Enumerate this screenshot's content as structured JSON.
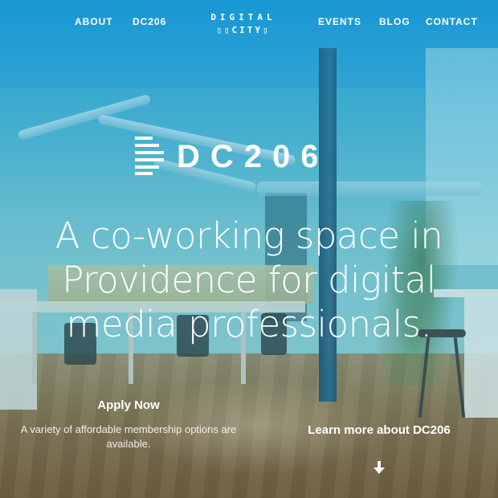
{
  "nav": {
    "left_links": [
      {
        "label": "ABOUT"
      },
      {
        "label": "DC206"
      }
    ],
    "logo": {
      "line1": "DIGITAL",
      "line2": "▯▯CITY▯"
    },
    "right_links": [
      {
        "label": "EVENTS"
      },
      {
        "label": "BLOG"
      },
      {
        "label": "CONTACT"
      }
    ]
  },
  "hero": {
    "brand_name": "DC206",
    "brand_icon": "stacked-lines-icon",
    "headline": "A co-working space in Providence for digital media professionals.",
    "apply": {
      "label": "Apply Now",
      "description": "A variety of affordable membership options are available."
    },
    "learn_more": {
      "label": "Learn more about DC206",
      "icon": "arrow-down-icon"
    }
  },
  "colors": {
    "overlay_tint": "#1596d2",
    "text": "#ffffff"
  }
}
